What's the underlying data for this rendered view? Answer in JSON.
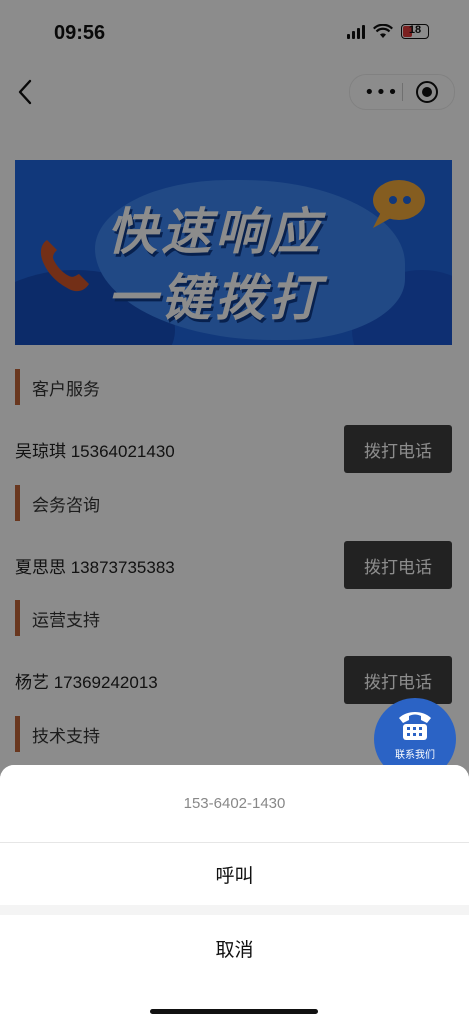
{
  "status": {
    "time": "09:56",
    "battery": "18"
  },
  "nav": {
    "more_icon": "more-dots-icon",
    "target_icon": "target-icon"
  },
  "banner": {
    "line1": "快速响应",
    "line2": "一键拨打"
  },
  "sections": [
    {
      "title": "客户服务",
      "contact": "吴琼琪 15364021430",
      "button": "拨打电话"
    },
    {
      "title": "会务咨询",
      "contact": "夏思思 13873735383",
      "button": "拨打电话"
    },
    {
      "title": "运营支持",
      "contact": "杨艺 17369242013",
      "button": "拨打电话"
    },
    {
      "title": "技术支持"
    }
  ],
  "fab": {
    "label": "联系我们"
  },
  "sheet": {
    "number": "153-6402-1430",
    "call": "呼叫",
    "cancel": "取消"
  },
  "colors": {
    "accent_bar": "#c0643a",
    "button_bg": "#3f3f3f",
    "banner_bg": "#1f66e0",
    "fab_bg": "#2b63c5"
  }
}
